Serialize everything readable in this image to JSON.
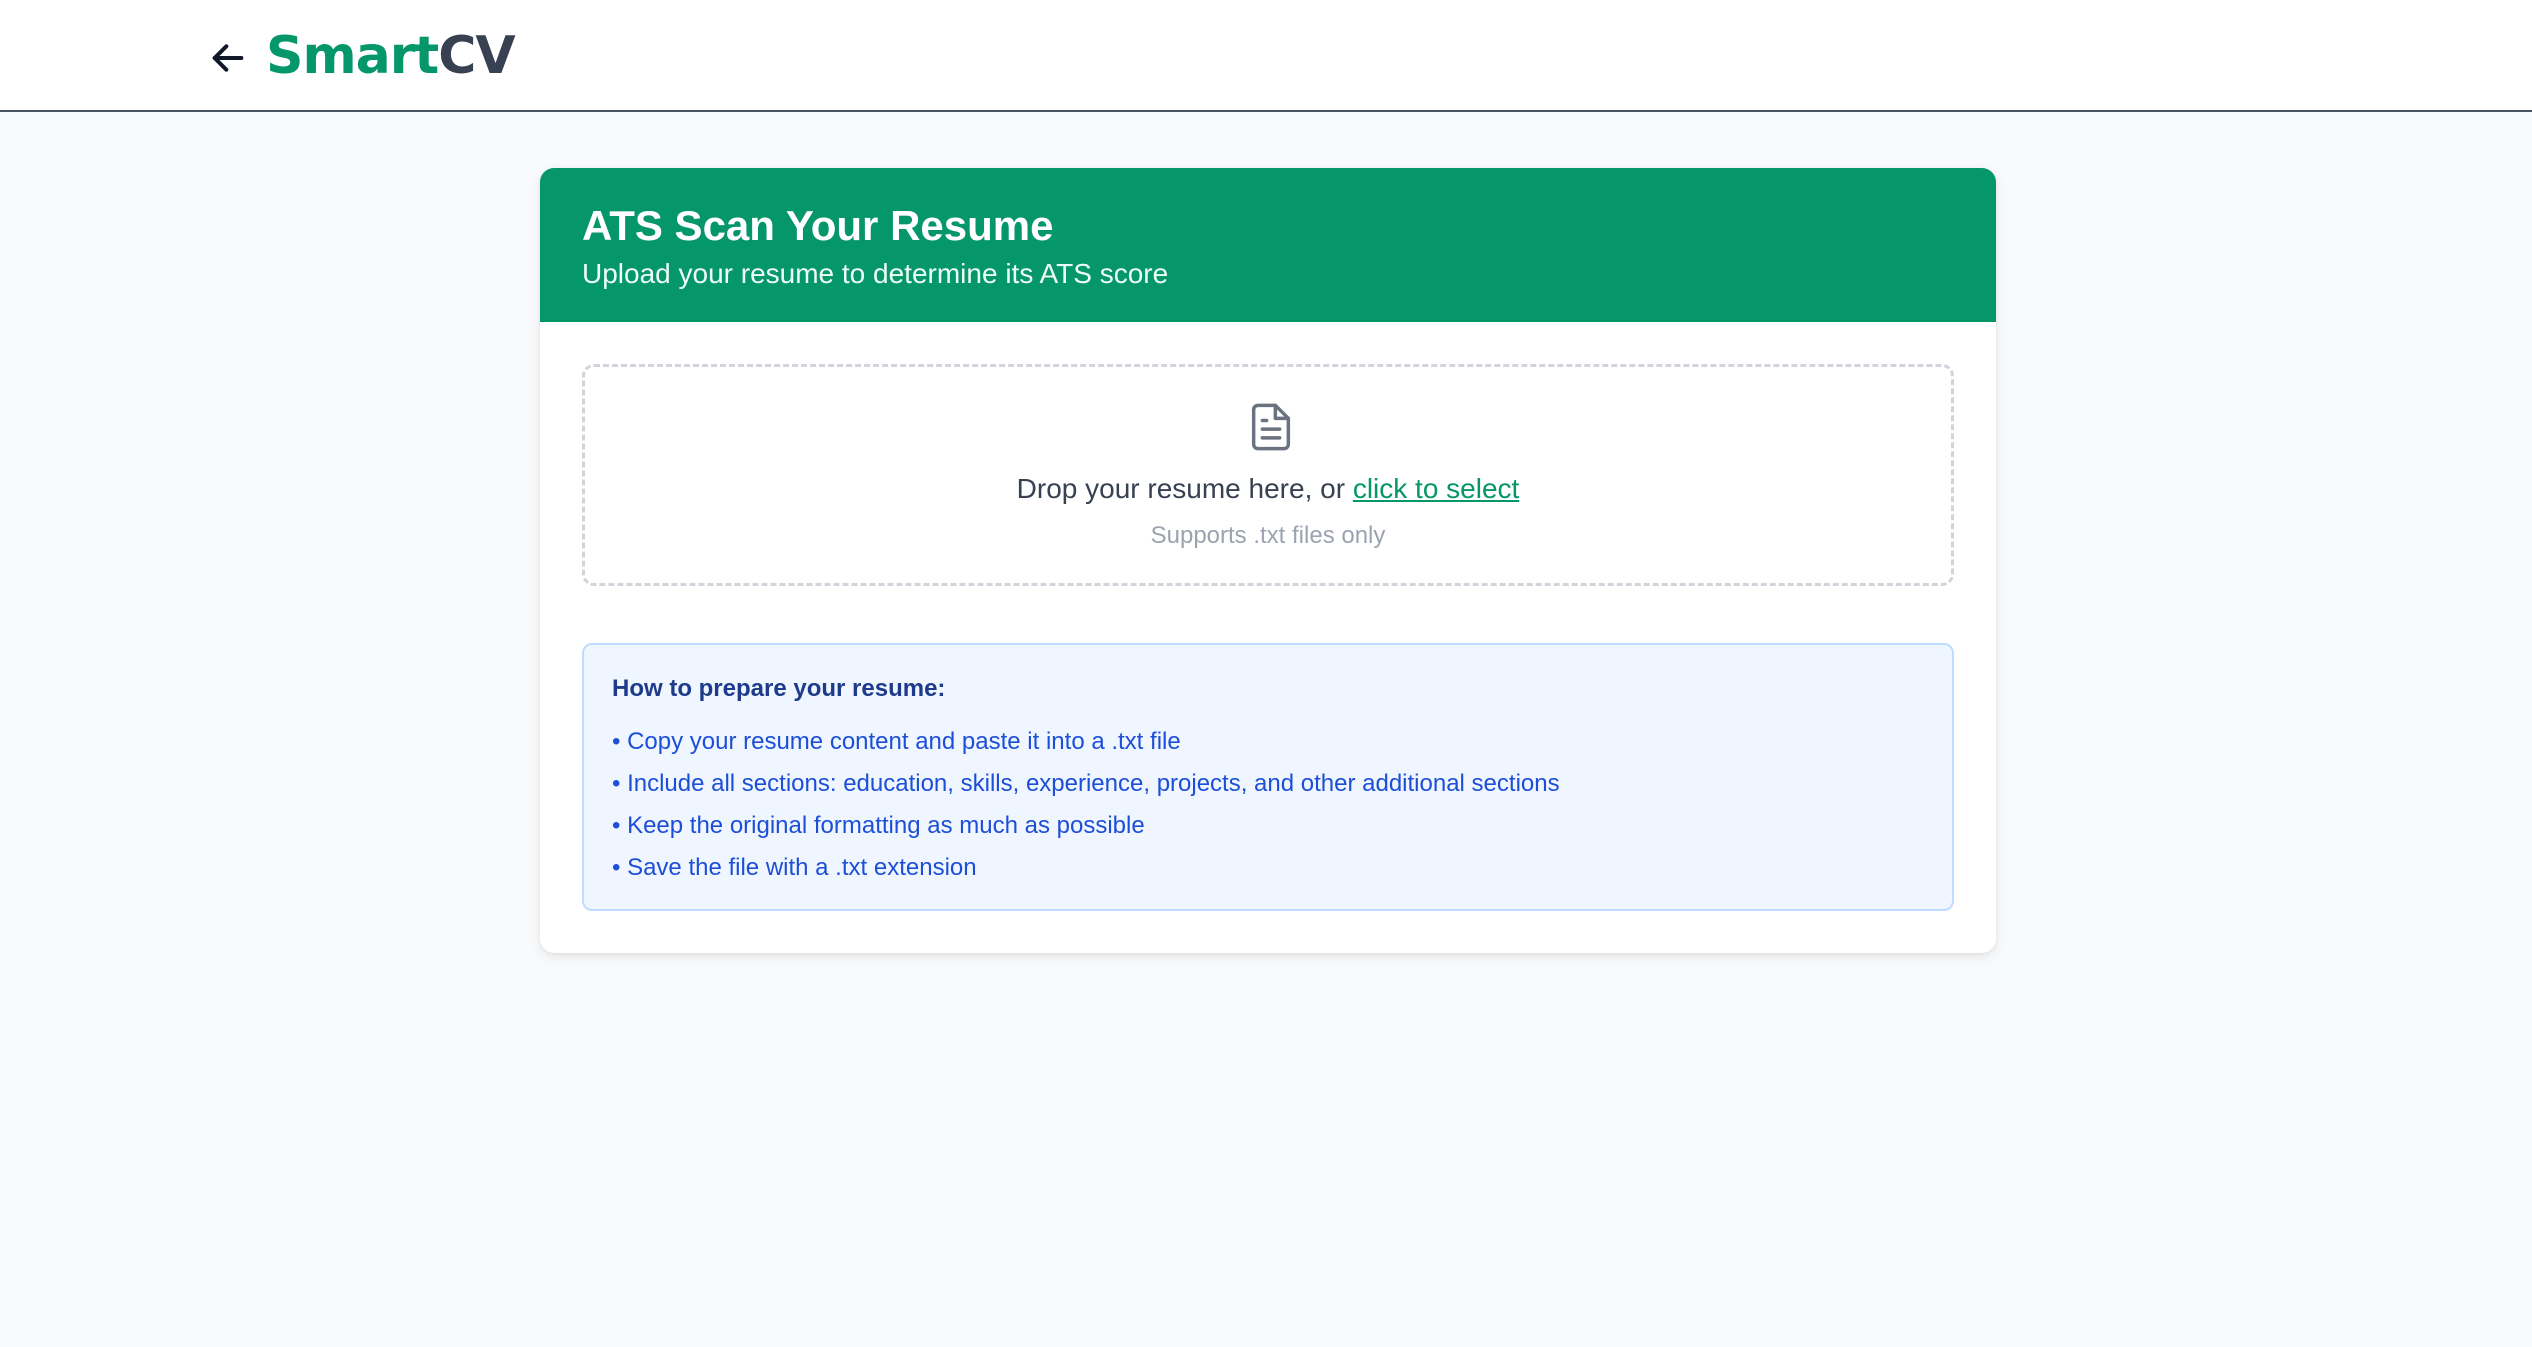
{
  "header": {
    "back_icon": "arrow-left-icon",
    "logo_part1": "Smart",
    "logo_part2": "CV",
    "colors": {
      "brand_green": "#059669",
      "brand_dark": "#374151"
    }
  },
  "card": {
    "title": "ATS Scan Your Resume",
    "subtitle": "Upload your resume to determine its ATS score",
    "accent_color": "#059669"
  },
  "dropzone": {
    "icon": "document-icon",
    "text": "Drop your resume here, or",
    "link_text": "click to select",
    "hint": "Supports .txt files only"
  },
  "tips": {
    "title": "How to prepare your resume:",
    "items": [
      "• Copy your resume content and paste it into a .txt file",
      "• Include all sections: education, skills, experience, projects, and other additional sections",
      "• Keep the original formatting as much as possible",
      "• Save the file with a .txt extension"
    ]
  }
}
